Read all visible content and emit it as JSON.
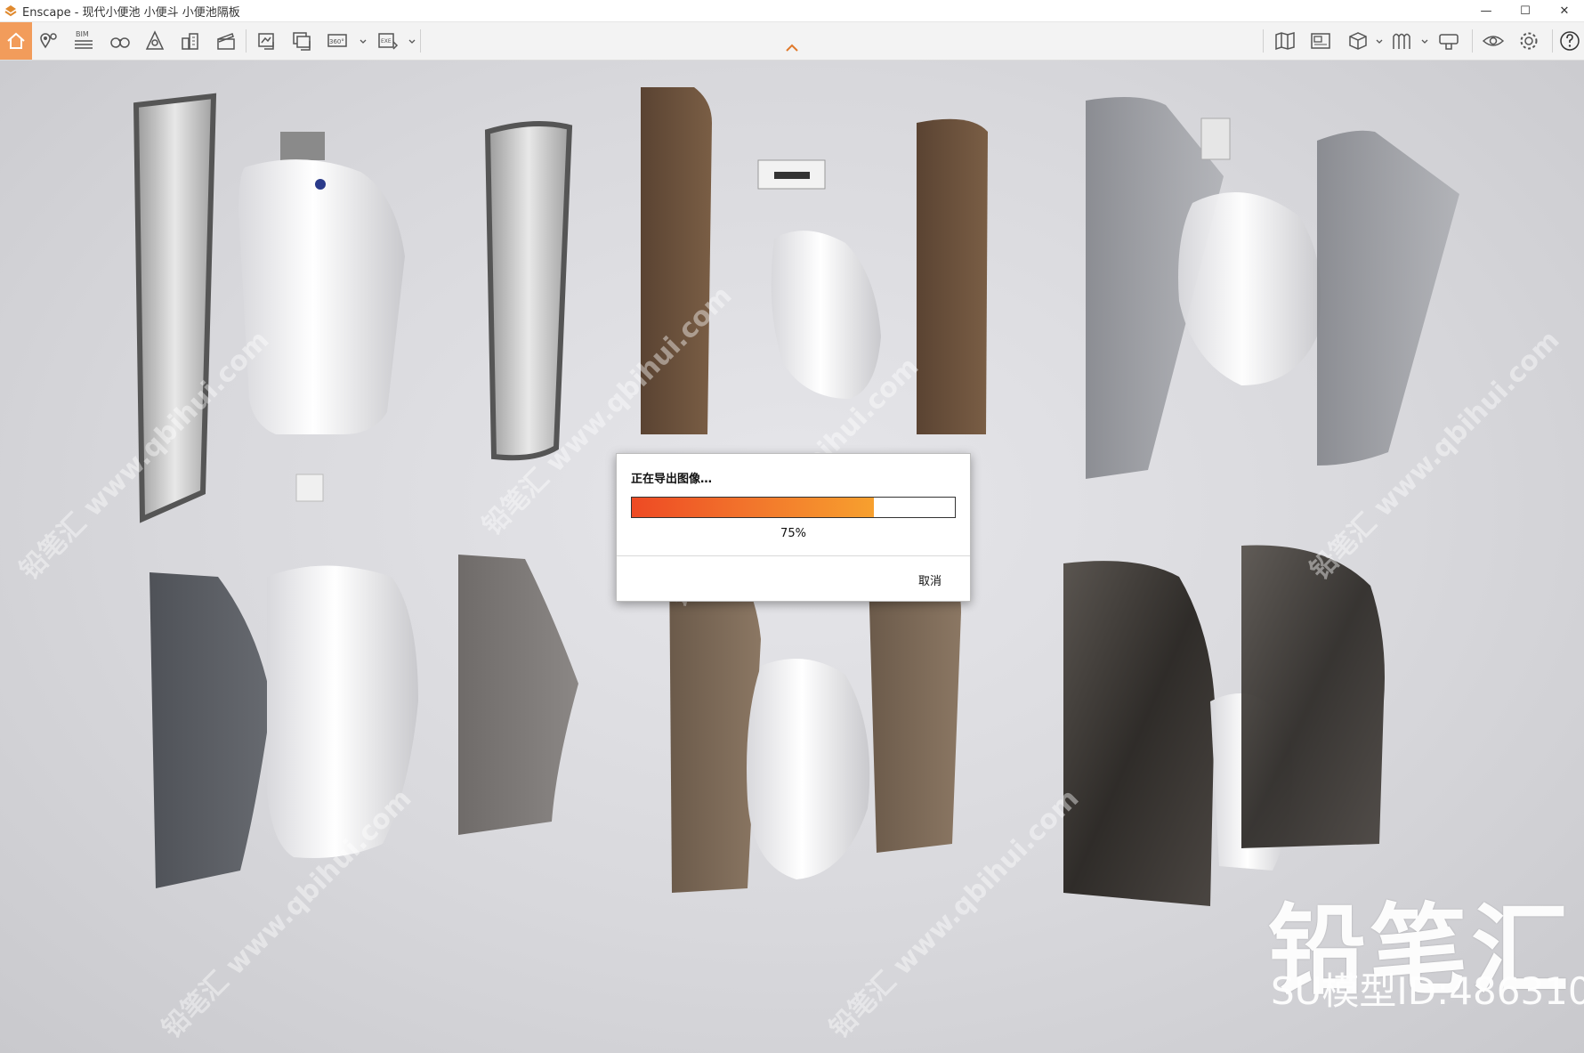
{
  "window": {
    "title": "Enscape - 现代小便池 小便斗 小便池隔板",
    "controls": {
      "minimize": "—",
      "maximize": "☐",
      "close": "✕"
    }
  },
  "toolbar": {
    "bim_label": "BIM",
    "panorama_label": "360°",
    "exe_label": "EXE",
    "icons": [
      "home-icon",
      "location-pin-icon",
      "bim-icon",
      "binoculars-icon",
      "sun-icon",
      "buildings-icon",
      "video-clapper-icon",
      "screenshot-icon",
      "batch-render-icon",
      "panorama-icon",
      "export-exe-icon",
      "map-icon",
      "views-icon",
      "cube-icon",
      "asset-library-icon",
      "material-editor-icon",
      "visual-settings-icon",
      "settings-icon",
      "help-icon"
    ],
    "accent": "#f29c5b"
  },
  "dialog": {
    "title": "正在导出图像…",
    "progress": 0.75,
    "progress_label": "75%",
    "cancel_label": "取消"
  },
  "watermark": {
    "text": "铅笔汇 www.qbihui.com",
    "brand": "铅笔汇",
    "model_id": "SU模型ID:486310"
  }
}
